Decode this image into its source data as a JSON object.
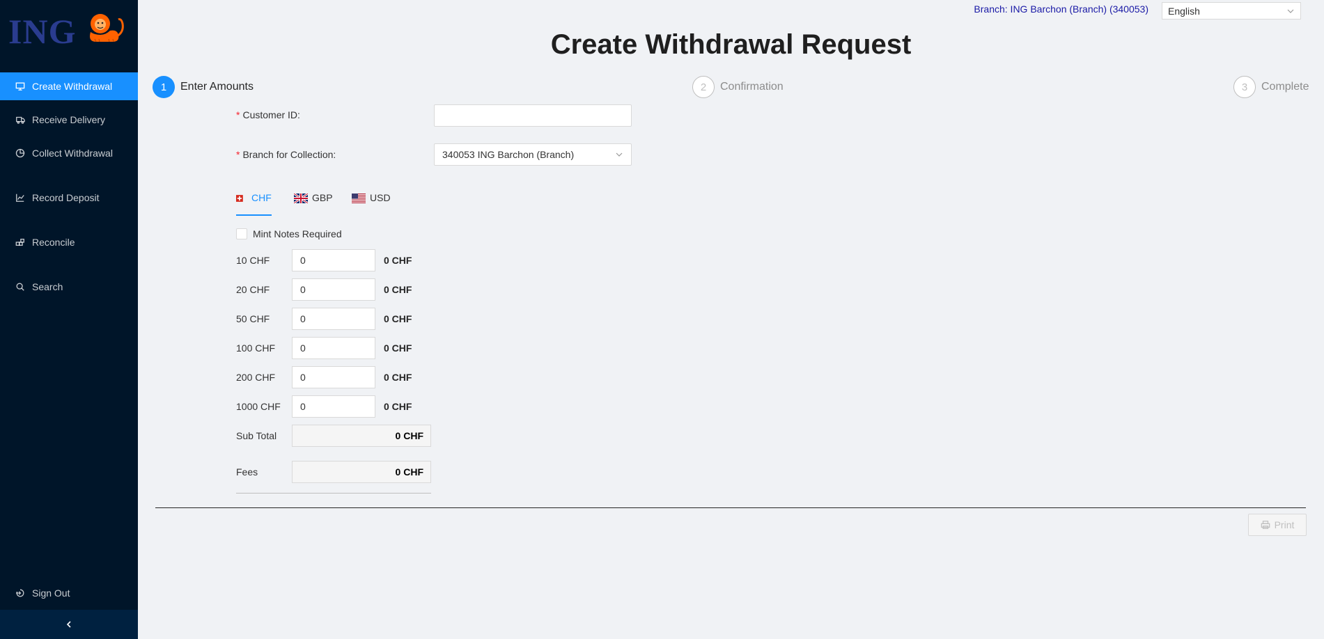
{
  "brand": {
    "logo_text": "ING"
  },
  "sidebar": {
    "items": [
      {
        "label": "Create Withdrawal",
        "icon": "monitor-icon",
        "active": true
      },
      {
        "label": "Receive Delivery",
        "icon": "truck-icon",
        "active": false
      },
      {
        "label": "Collect Withdrawal",
        "icon": "pie-chart-icon",
        "active": false
      },
      {
        "label": "Record Deposit",
        "icon": "line-chart-icon",
        "active": false
      },
      {
        "label": "Reconcile",
        "icon": "blocks-icon",
        "active": false
      },
      {
        "label": "Search",
        "icon": "search-icon",
        "active": false
      }
    ],
    "sign_out": "Sign Out",
    "collapse_icon": "chevron-left-icon"
  },
  "header": {
    "branch": "Branch: ING Barchon (Branch) (340053)",
    "language": "English"
  },
  "page": {
    "title": "Create Withdrawal Request"
  },
  "steps": [
    {
      "num": "1",
      "label": "Enter Amounts"
    },
    {
      "num": "2",
      "label": "Confirmation"
    },
    {
      "num": "3",
      "label": "Complete"
    }
  ],
  "form": {
    "customer_id_label": "Customer ID",
    "customer_id_value": "",
    "branch_label": "Branch for Collection",
    "branch_value": "340053 ING Barchon (Branch)"
  },
  "tabs": [
    {
      "label": "CHF",
      "active": true
    },
    {
      "label": "GBP",
      "active": false
    },
    {
      "label": "USD",
      "active": false
    }
  ],
  "mint": {
    "label": "Mint Notes Required",
    "checked": false
  },
  "denominations": [
    {
      "label": "10 CHF",
      "value": "0",
      "total": "0 CHF"
    },
    {
      "label": "20 CHF",
      "value": "0",
      "total": "0 CHF"
    },
    {
      "label": "50 CHF",
      "value": "0",
      "total": "0 CHF"
    },
    {
      "label": "100 CHF",
      "value": "0",
      "total": "0 CHF"
    },
    {
      "label": "200 CHF",
      "value": "0",
      "total": "0 CHF"
    },
    {
      "label": "1000 CHF",
      "value": "0",
      "total": "0 CHF"
    }
  ],
  "summary": {
    "subtotal_label": "Sub Total",
    "subtotal_value": "0 CHF",
    "fees_label": "Fees",
    "fees_value": "0 CHF"
  },
  "actions": {
    "print_label": "Print"
  },
  "colors": {
    "sidebar_bg": "#001529",
    "accent": "#1890ff",
    "page_bg": "#f0f2f5",
    "required": "#f5222d"
  }
}
